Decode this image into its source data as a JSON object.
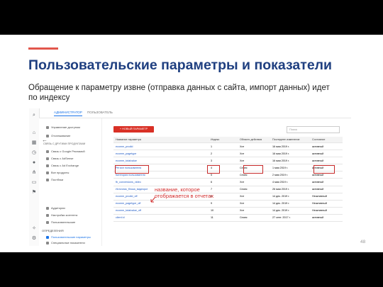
{
  "slide": {
    "title": "Пользовательские параметры и показатели",
    "subtitle": "Обращение к параметру извне (отправка данных с сайта, импорт данных) идет по индексу",
    "annotation": "название, которое отображается в отчетах",
    "page_number": "48"
  },
  "shot": {
    "tabs": [
      "АДМИНИСТРАТОР",
      "ПОЛЬЗОВАТЕЛЬ"
    ],
    "menu": [
      "Управление доступом",
      "Отслеживание",
      "Связь с Google Рекламой",
      "Связь с AdSense",
      "Связь с Ad Exchange",
      "Все продукты",
      "Постбэки",
      "Аудитории",
      "Настройки контента",
      "Пользовательские",
      "ОПРЕДЕЛЕНИЯ",
      "Пользовательские параметры",
      "Специальные показатели"
    ],
    "menu_section": "СВЯЗЬ С ДРУГИМИ ПРОДУКТАМИ",
    "new_button": "+ НОВЫЙ ПАРАМЕТР",
    "search_placeholder": "Поиск",
    "columns": [
      "Название параметра",
      "Индекс",
      "Область действия",
      "Последнее изменение",
      "Состояние"
    ],
    "rows": [
      [
        "ecomm_prodid",
        "1",
        "Хит",
        "16 мая 2019 г.",
        "активный"
      ],
      [
        "ecomm_pagetype",
        "2",
        "Хит",
        "16 мая 2019 г.",
        "активный"
      ],
      [
        "ecomm_totalvalue",
        "3",
        "Хит",
        "16 мая 2019 г.",
        "активный"
      ],
      [
        "Регион пользователя",
        "4",
        "Сеанс",
        "1 мая 2019 г.",
        "активный"
      ],
      [
        "Категория пользователя",
        "5",
        "Сеанс",
        "2 мая 2019 г.",
        "активный"
      ],
      [
        "fb_conversions_video",
        "6",
        "Хит",
        "4 мая 2019 г.",
        "активный"
      ],
      [
        "Источник_блока_видеоркт",
        "7",
        "Сеанс",
        "26 мая 2019 г.",
        "активный"
      ],
      [
        "ecomm_prodid_off",
        "8",
        "Хит",
        "14 дек. 2019 г.",
        "Неактивный"
      ],
      [
        "ecomm_pagetype_off",
        "9",
        "Хит",
        "14 дек. 2019 г.",
        "Неактивный"
      ],
      [
        "ecomm_totalvalue_off",
        "10",
        "Хит",
        "14 дек. 2019 г.",
        "Неактивный"
      ],
      [
        "client id",
        "11",
        "Сеанс",
        "27 сент. 2017 г.",
        "активный"
      ]
    ]
  }
}
